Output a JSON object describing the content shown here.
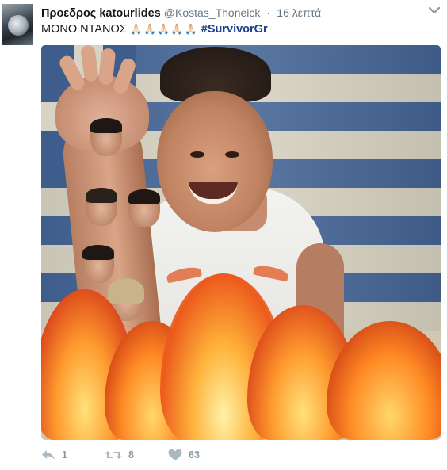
{
  "tweet": {
    "author_name": "Προεδρος katourlides",
    "handle": "@Kostas_Thoneick",
    "separator": "·",
    "time": "16 λεπτά",
    "text": "ΜΟΝΟ ΝΤΑΝΟΣ",
    "emoji": "🙏🏻🙏🏻🙏🏻🙏🏻🙏🏻",
    "hashtag": "#SurvivorGr"
  },
  "actions": {
    "reply_count": "1",
    "retweet_count": "8",
    "like_count": "63"
  },
  "colors": {
    "hashtag": "#1b3f8f",
    "muted": "#8899a6",
    "flag_blue": "#3f5d8c"
  },
  "icons": [
    "avatar-image",
    "chevron-down-icon",
    "reply-icon",
    "retweet-icon",
    "heart-icon"
  ]
}
